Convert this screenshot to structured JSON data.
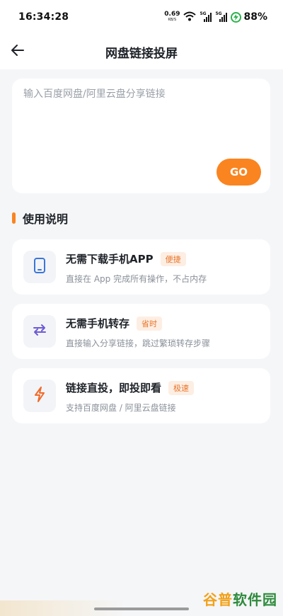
{
  "status_bar": {
    "time": "16:34:28",
    "net_speed_value": "0.69",
    "net_speed_unit": "KB/S",
    "signal_tag": "5G",
    "battery": "88%"
  },
  "header": {
    "title": "网盘链接投屏",
    "back_icon": "arrow-left-icon"
  },
  "link_input": {
    "placeholder": "输入百度网盘/阿里云盘分享链接",
    "value": "",
    "go_label": "GO"
  },
  "section": {
    "title": "使用说明"
  },
  "features": [
    {
      "title": "无需下载手机APP",
      "badge": "便捷",
      "desc": "直接在 App 完成所有操作，不占内存",
      "icon": "phone-icon"
    },
    {
      "title": "无需手机转存",
      "badge": "省时",
      "desc": "直接输入分享链接，跳过繁琐转存步骤",
      "icon": "swap-arrows-icon"
    },
    {
      "title": "链接直投，即投即看",
      "badge": "极速",
      "desc": "支持百度网盘 / 阿里云盘链接",
      "icon": "lightning-icon"
    }
  ],
  "watermark": {
    "part_a": "谷普",
    "part_b": "软件园"
  },
  "colors": {
    "accent": "#fa8420",
    "badge_bg": "#fdeee3",
    "badge_text": "#e8762c",
    "phone_icon": "#3a76d8",
    "swap_icon": "#6b5bd6",
    "lightning_icon": "#f06a2a",
    "page_bg": "#f5f6f8"
  }
}
